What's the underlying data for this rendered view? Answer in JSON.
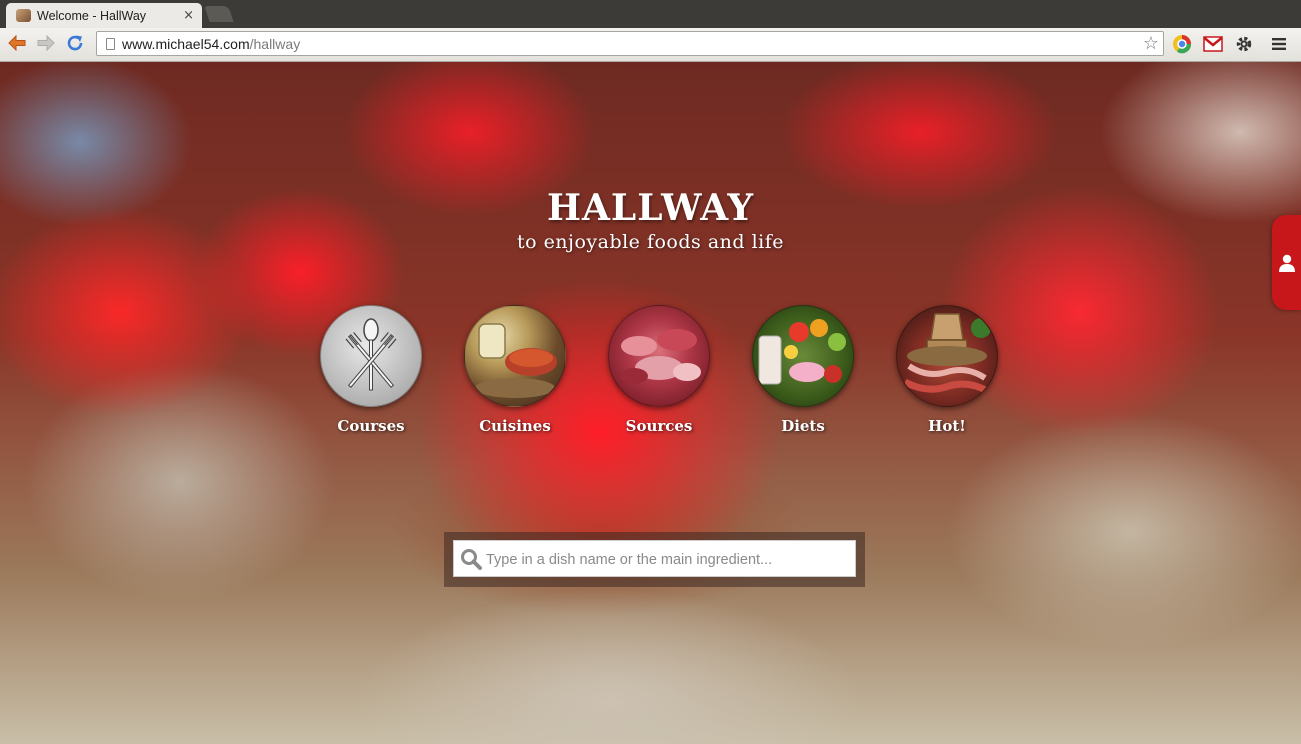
{
  "browser": {
    "tab_title": "Welcome - HallWay",
    "tab_close": "×",
    "url_host": "www.michael54.com",
    "url_path": "/hallway",
    "star": "☆",
    "icons": [
      "back-arrow-icon",
      "forward-arrow-icon",
      "reload-icon",
      "page-icon",
      "bookmark-star-icon",
      "chrome-extension-icon",
      "gmail-icon",
      "settings-wrench-icon",
      "menu-icon"
    ]
  },
  "hero": {
    "title": "HALLWAY",
    "subtitle": "to enjoyable foods and life"
  },
  "categories": [
    {
      "label": "Courses",
      "icon": "cutlery-icon"
    },
    {
      "label": "Cuisines",
      "icon": "cuisine-dish-icon"
    },
    {
      "label": "Sources",
      "icon": "raw-meat-icon"
    },
    {
      "label": "Diets",
      "icon": "fruits-icon"
    },
    {
      "label": "Hot!",
      "icon": "hotpot-icon"
    }
  ],
  "search": {
    "placeholder": "Type in a dish name or the main ingredient...",
    "value": ""
  },
  "side_tab": {
    "icon": "user-icon"
  },
  "colors": {
    "accent_red": "#c8171b",
    "chrome_dark": "#3c3b37"
  }
}
